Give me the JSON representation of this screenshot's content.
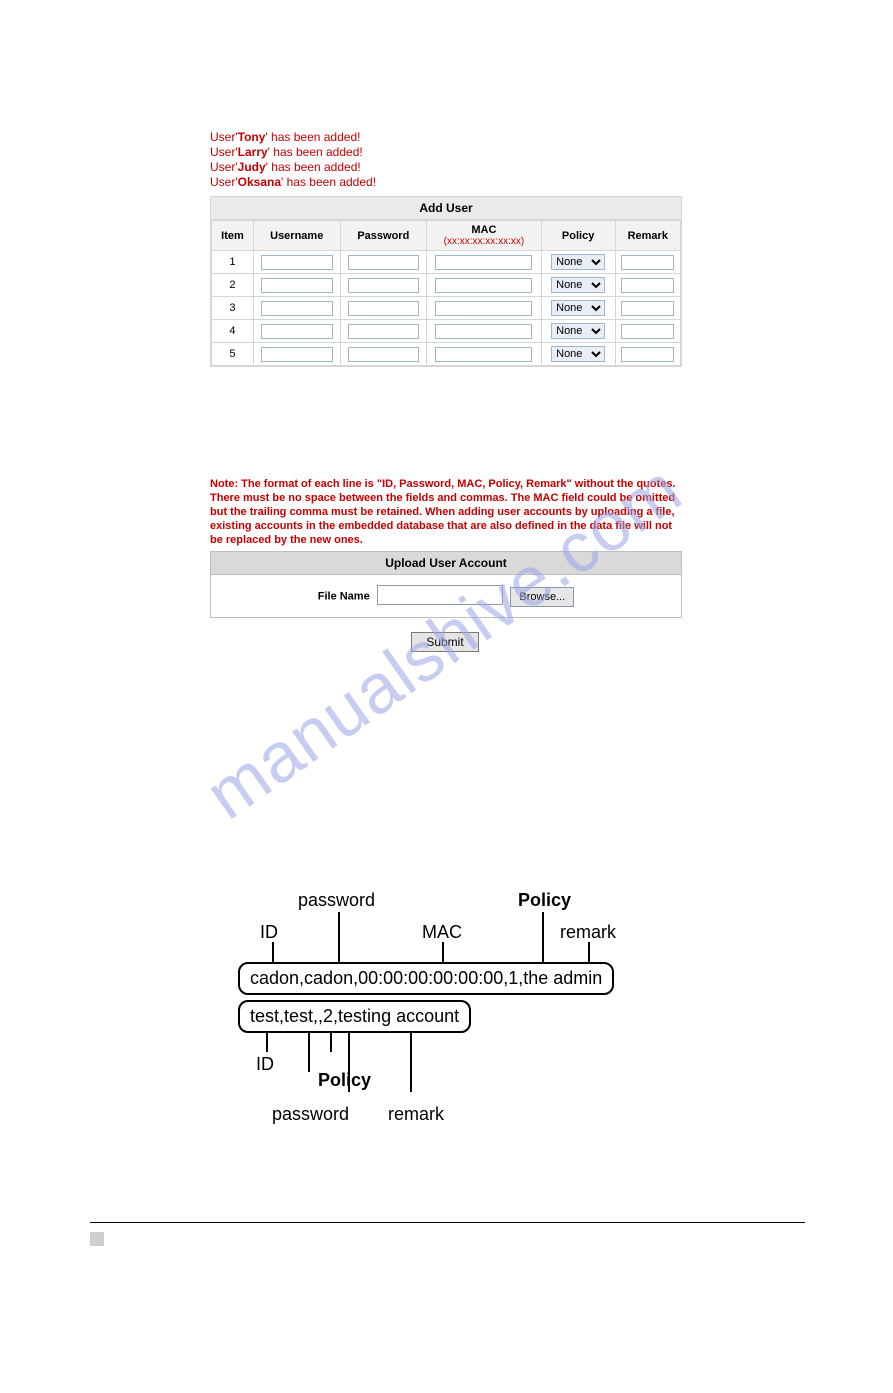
{
  "status_messages": [
    {
      "prefix": "User",
      "name": "Tony",
      "suffix": "has been added!"
    },
    {
      "prefix": "User",
      "name": "Larry",
      "suffix": "has been added!"
    },
    {
      "prefix": "User",
      "name": "Judy",
      "suffix": "has been added!"
    },
    {
      "prefix": "User",
      "name": "Oksana",
      "suffix": "has been added!"
    }
  ],
  "add_user_table": {
    "title": "Add User",
    "columns": {
      "item": "Item",
      "username": "Username",
      "password": "Password",
      "mac": "MAC",
      "mac_format": "(xx:xx:xx:xx:xx:xx)",
      "policy": "Policy",
      "remark": "Remark"
    },
    "rows": [
      {
        "item": "1",
        "policy": "None"
      },
      {
        "item": "2",
        "policy": "None"
      },
      {
        "item": "3",
        "policy": "None"
      },
      {
        "item": "4",
        "policy": "None"
      },
      {
        "item": "5",
        "policy": "None"
      }
    ]
  },
  "note_text": "Note: The format of each line is \"ID, Password, MAC, Policy, Remark\" without the quotes. There must be no space between the fields and commas. The MAC field could be omitted but the trailing comma must be retained. When adding user accounts by uploading a file, existing accounts in the embedded database that are also defined in the data file will not be replaced by the new ones.",
  "upload": {
    "title": "Upload User Account",
    "file_label": "File Name",
    "browse": "Browse...",
    "submit": "Submit"
  },
  "watermark": "manualshive.com",
  "diagram": {
    "top_labels": {
      "password": "password",
      "policy": "Policy",
      "id": "ID",
      "mac": "MAC",
      "remark": "remark"
    },
    "line1": "cadon,cadon,00:00:00:00:00:00,1,the admin",
    "line2": "test,test,,2,testing account",
    "bottom_labels": {
      "id": "ID",
      "policy": "Policy",
      "password": "password",
      "remark": "remark"
    }
  }
}
